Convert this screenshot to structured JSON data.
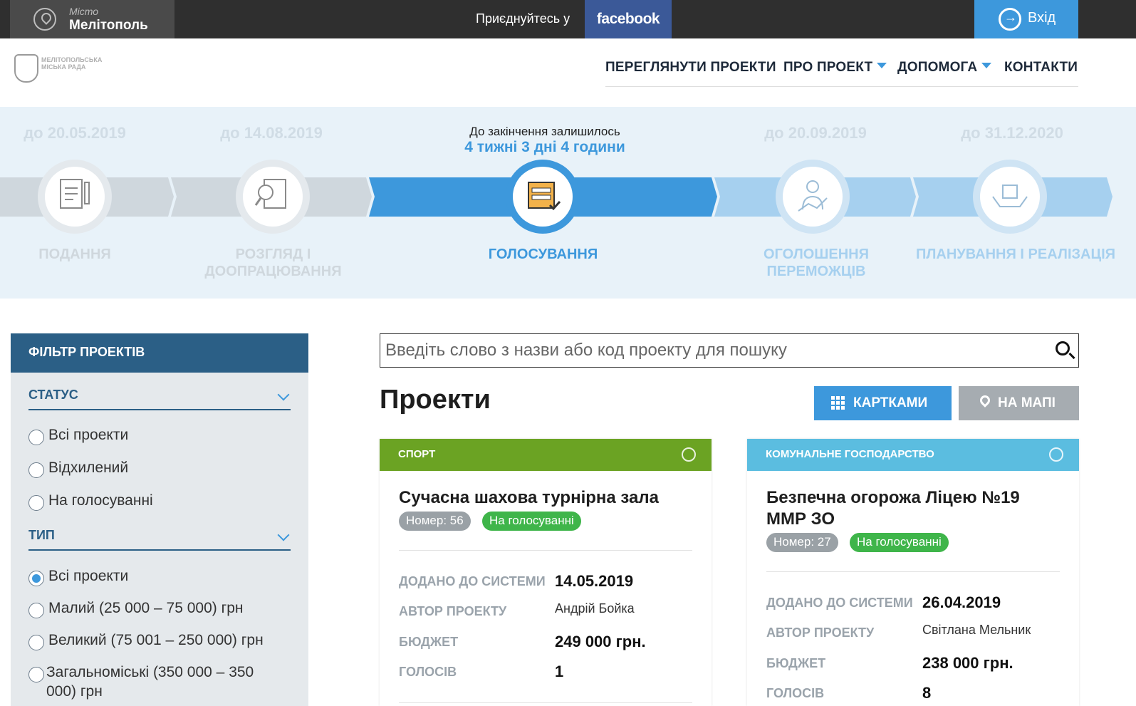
{
  "topbar": {
    "city_label": "Місто",
    "city_name": "Мелітополь",
    "join_text": "Приєднуйтесь у",
    "facebook_label": "facebook",
    "login_label": "Вхід"
  },
  "logo": {
    "text": "МЕЛІТОПОЛЬСЬКА МІСЬКА РАДА"
  },
  "nav": {
    "items": [
      "ПЕРЕГЛЯНУТИ ПРОЕКТИ",
      "ПРО ПРОЕКТ",
      "ДОПОМОГА",
      "КОНТАКТИ"
    ]
  },
  "steps": {
    "countdown_label": "До закінчення залишилось",
    "countdown_value": "4 тижні 3 дні 4 години",
    "items": [
      {
        "date": "до 20.05.2019",
        "name": "ПОДАННЯ",
        "icon": "document-pen-icon"
      },
      {
        "date": "до 14.08.2019",
        "name": "РОЗГЛЯД І ДООПРАЦЮВАННЯ",
        "icon": "magnifier-document-icon"
      },
      {
        "date": "",
        "name": "ГОЛОСУВАННЯ",
        "icon": "ballot-icon"
      },
      {
        "date": "до 20.09.2019",
        "name": "ОГОЛОШЕННЯ ПЕРЕМОЖЦІВ",
        "icon": "person-chart-icon"
      },
      {
        "date": "до 31.12.2020",
        "name": "ПЛАНУВАННЯ І РЕАЛІЗАЦІЯ",
        "icon": "hands-box-icon"
      }
    ],
    "colors": {
      "active": "#3d98dc",
      "done": "#c8d1d8",
      "future": "#a6d0ef"
    }
  },
  "filter": {
    "title": "ФІЛЬТР ПРОЕКТІВ",
    "status_title": "СТАТУС",
    "status_options": [
      "Всі проекти",
      "Відхилений",
      "На голосуванні"
    ],
    "type_title": "ТИП",
    "type_options": [
      "Всі проекти",
      "Малий (25 000 – 75 000) грн",
      "Великий (75 001 – 250 000) грн",
      "Загальноміські (350 000 – 350",
      "000) грн"
    ],
    "type_selected": "Всі проекти"
  },
  "search": {
    "placeholder": "Введіть слово з назви або код проекту для пошуку"
  },
  "projects": {
    "title": "Проекти",
    "view_cards": "КАРТКАМИ",
    "view_map": "НА МАПІ"
  },
  "cards": [
    {
      "category": "СПОРТ",
      "category_color": "#6ba323",
      "title": "Сучасна шахова турнірна зала",
      "number": "Номер: 56",
      "status": "На голосуванні",
      "added_label": "ДОДАНО ДО СИСТЕМИ",
      "added": "14.05.2019",
      "author_label": "АВТОР ПРОЕКТУ",
      "author": "Андрій Бойка",
      "budget_label": "БЮДЖЕТ",
      "budget": "249 000 грн.",
      "votes_label": "ГОЛОСІВ",
      "votes": "1"
    },
    {
      "category": "КОМУНАЛЬНЕ ГОСПОДАРСТВО",
      "category_color": "#5bbde0",
      "title_line1": "Безпечна огорожа Ліцею №19",
      "title_line2": "ММР ЗО",
      "number": "Номер: 27",
      "status": "На голосуванні",
      "added_label": "ДОДАНО ДО СИСТЕМИ",
      "added": "26.04.2019",
      "author_label": "АВТОР ПРОЕКТУ",
      "author": "Світлана Мельник",
      "budget_label": "БЮДЖЕТ",
      "budget": "238 000 грн.",
      "votes_label": "ГОЛОСІВ",
      "votes": "8"
    }
  ]
}
